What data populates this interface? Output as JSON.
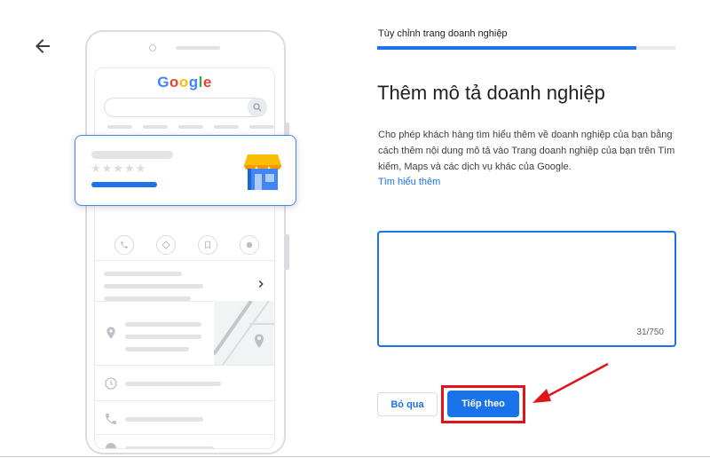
{
  "header": {
    "step_label": "Tùy chỉnh trang doanh nghiệp",
    "progress_percent": 87
  },
  "main": {
    "title": "Thêm mô tả doanh nghiệp",
    "description": "Cho phép khách hàng tìm hiểu thêm về doanh nghiệp của bạn bằng cách thêm nội dung mô tả vào Trang doanh nghiệp của bạn trên Tìm kiếm, Maps và các dịch vụ khác của Google.",
    "learn_more_label": "Tìm hiểu thêm",
    "description_field": {
      "value": "",
      "char_count": "31/750"
    },
    "skip_label": "Bỏ qua",
    "next_label": "Tiếp theo"
  },
  "illustration": {
    "logo_letters": [
      "G",
      "o",
      "o",
      "g",
      "l",
      "e"
    ],
    "logo_colors": [
      "#4285f4",
      "#ea4335",
      "#fbbc05",
      "#4285f4",
      "#34a853",
      "#ea4335"
    ],
    "stars": "★★★★★"
  },
  "colors": {
    "accent": "#1a73e8",
    "highlight": "#e1141c"
  },
  "icons": {
    "back": "arrow-left-icon",
    "search": "search-icon",
    "store": "storefront-icon",
    "location": "location-pin-icon",
    "clock": "clock-icon",
    "phone": "phone-icon",
    "web": "globe-icon",
    "chevron": "chevron-right-icon"
  }
}
